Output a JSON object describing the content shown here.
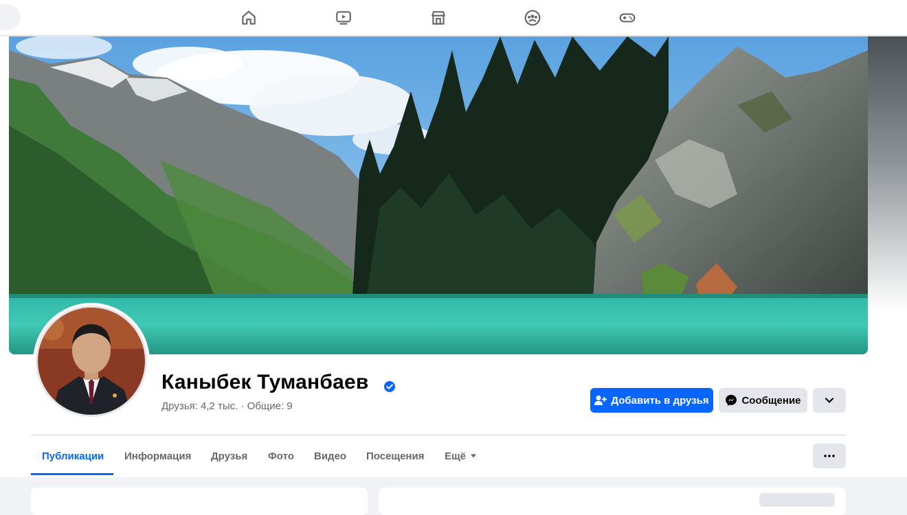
{
  "colors": {
    "accent": "#0866ff",
    "secondary_btn": "#e4e6eb",
    "muted_text": "#65676b"
  },
  "nav": {
    "icons": [
      "home-icon",
      "video-icon",
      "marketplace-icon",
      "groups-icon",
      "gaming-icon"
    ]
  },
  "profile": {
    "name": "Каныбек Туманбаев",
    "verified": true,
    "friends_line": "Друзья: 4,2 тыс. · Общие: 9"
  },
  "actions": {
    "add_friend": "Добавить в друзья",
    "message": "Сообщение"
  },
  "tabs": [
    {
      "label": "Публикации",
      "active": true
    },
    {
      "label": "Информация"
    },
    {
      "label": "Друзья"
    },
    {
      "label": "Фото"
    },
    {
      "label": "Видео"
    },
    {
      "label": "Посещения"
    },
    {
      "label": "Ещё"
    }
  ]
}
